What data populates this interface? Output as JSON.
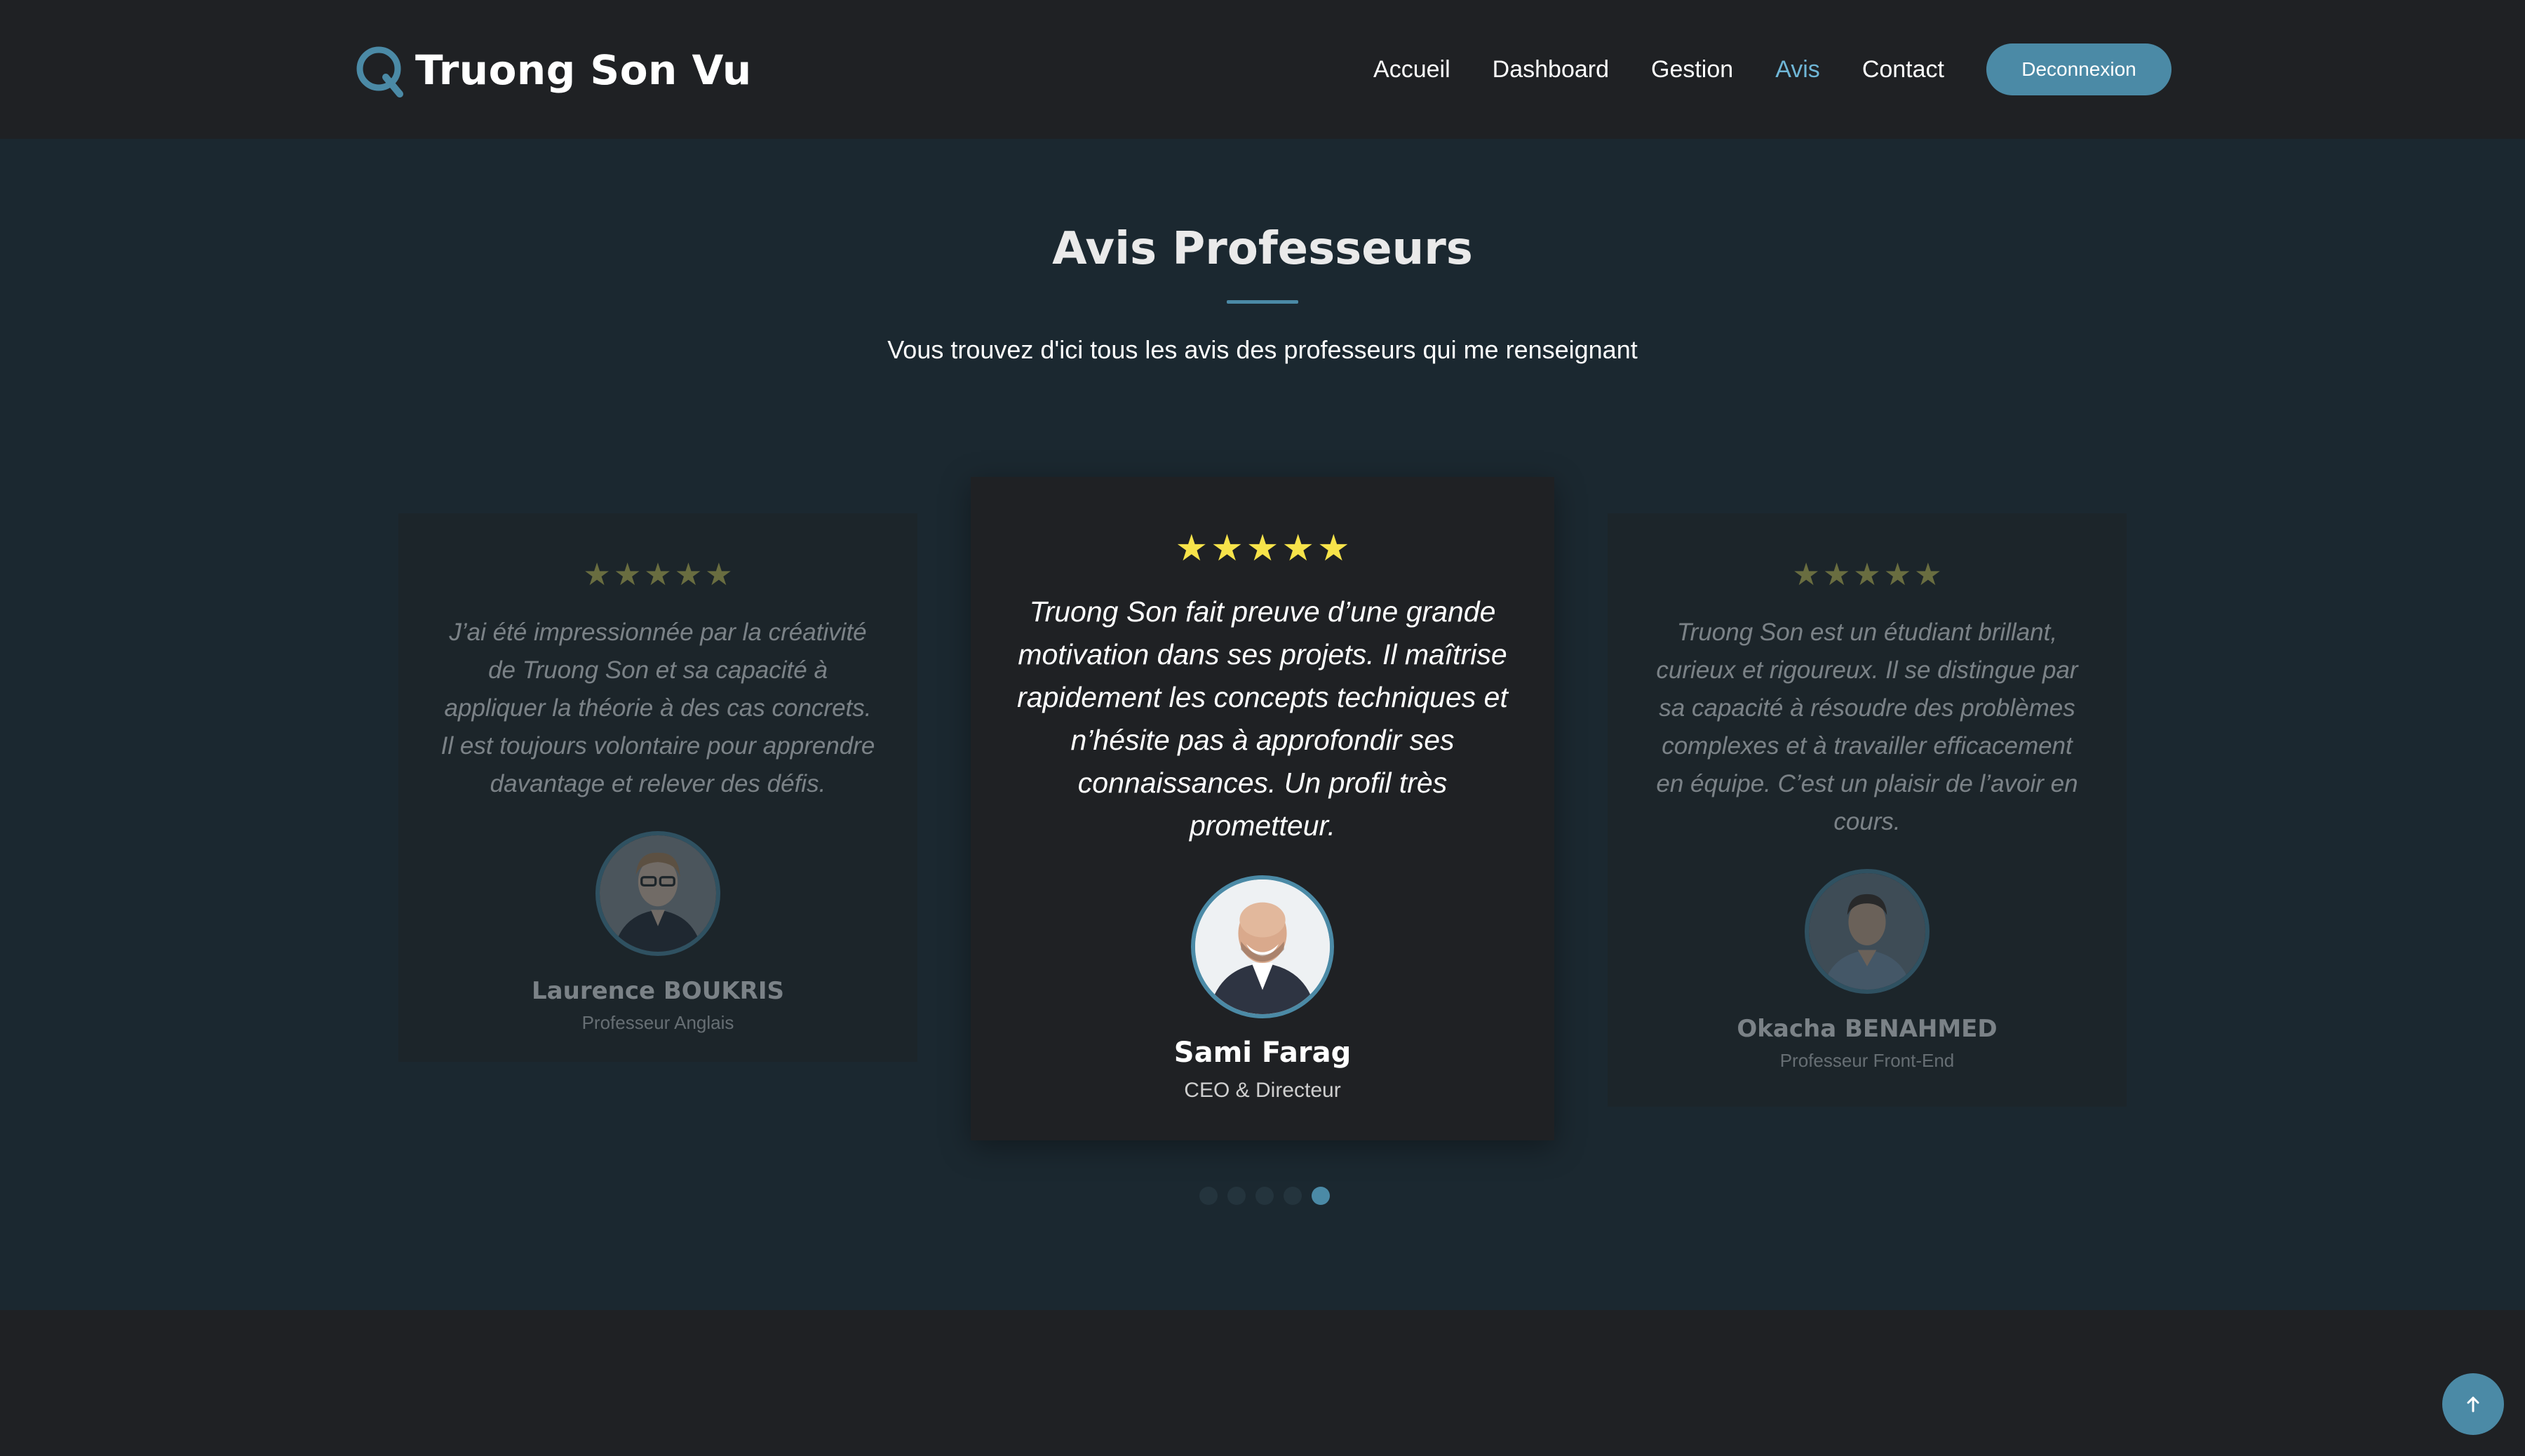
{
  "header": {
    "brand": "Truong Son Vu",
    "brand_icon": "q-logo-icon",
    "nav": [
      {
        "label": "Accueil",
        "active": false
      },
      {
        "label": "Dashboard",
        "active": false
      },
      {
        "label": "Gestion",
        "active": false
      },
      {
        "label": "Avis",
        "active": true
      },
      {
        "label": "Contact",
        "active": false
      }
    ],
    "logout_label": "Deconnexion"
  },
  "section": {
    "title": "Avis Professeurs",
    "subtitle": "Vous trouvez d'ici tous les avis des professeurs qui me renseignant"
  },
  "testimonials": [
    {
      "rating": 5,
      "quote": "J’ai été impressionnée par la créativité de Truong Son et sa capacité à appliquer la théorie à des cas concrets. Il est toujours volontaire pour apprendre davantage et relever des défis.",
      "name": "Laurence BOUKRIS",
      "role": "Professeur Anglais"
    },
    {
      "rating": 5,
      "quote": "Truong Son fait preuve d’une grande motivation dans ses projets. Il maîtrise rapidement les concepts techniques et n’hésite pas à approfondir ses connaissances. Un profil très prometteur.",
      "name": "Sami Farag",
      "role": "CEO & Directeur"
    },
    {
      "rating": 5,
      "quote": "Truong Son est un étudiant brillant, curieux et rigoureux. Il se distingue par sa capacité à résoudre des problèmes complexes et à travailler efficacement en équipe. C’est un plaisir de l’avoir en cours.",
      "name": "Okacha BENAHMED",
      "role": "Professeur Front-End"
    }
  ],
  "carousel": {
    "dot_count": 5,
    "active_index": 4
  },
  "colors": {
    "accent": "#4b8aa6",
    "active_nav": "#6fb6d6",
    "star": "#f7e34a",
    "section_bg": "#1b2830",
    "card_bg": "#1f2124"
  },
  "back_to_top_icon": "arrow-up-icon"
}
